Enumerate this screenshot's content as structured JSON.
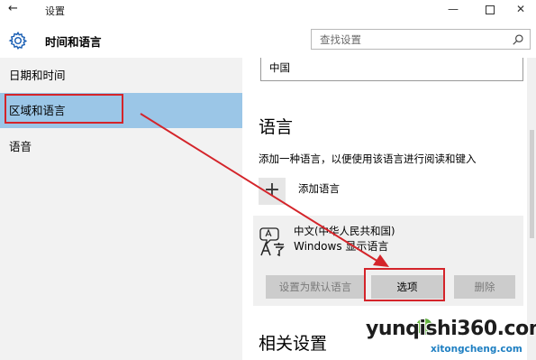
{
  "window": {
    "title": "设置",
    "back_glyph": "←",
    "minimize_glyph": "—",
    "close_glyph": "✕"
  },
  "header": {
    "title": "时间和语言",
    "search_placeholder": "查找设置"
  },
  "sidebar": {
    "items": [
      {
        "label": "日期和时间",
        "selected": false
      },
      {
        "label": "区域和语言",
        "selected": true
      },
      {
        "label": "语音",
        "selected": false
      }
    ]
  },
  "content": {
    "region_value": "中国",
    "language_heading": "语言",
    "language_desc": "添加一种语言，以便使用该语言进行阅读和键入",
    "add_language_label": "添加语言",
    "add_icon_glyph": "+",
    "language_item": {
      "name": "中文(中华人民共和国)",
      "subtitle": "Windows 显示语言"
    },
    "buttons": {
      "set_default": "设置为默认语言",
      "options": "选项",
      "remove": "删除"
    },
    "related_heading": "相关设置"
  },
  "watermark": {
    "text": "yunqishi360.com",
    "subtext": "xitongcheng.com"
  },
  "colors": {
    "selected_nav": "#9bc6e7",
    "sidebar_bg": "#f2f2f2",
    "annotation_red": "#d4242a"
  }
}
